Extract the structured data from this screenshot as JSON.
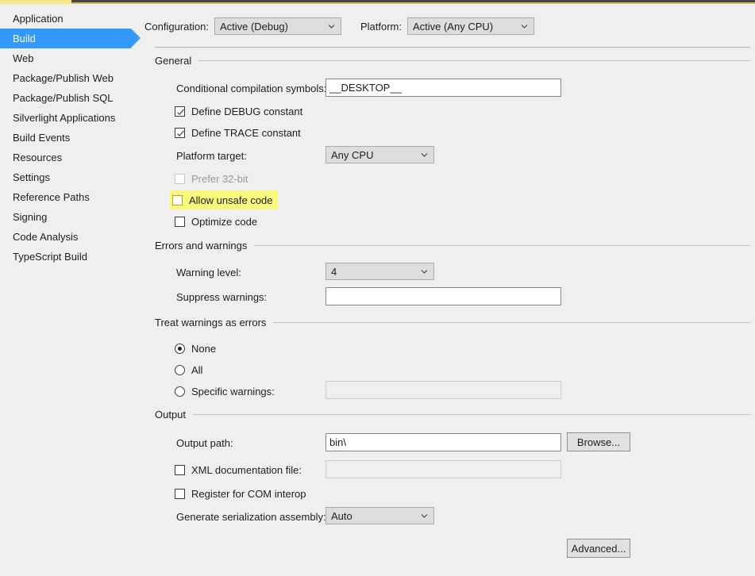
{
  "window": {
    "accent_yellow": "#f7e98a",
    "accent_dark": "#3f4551",
    "selection_blue": "#3399ff",
    "highlight_yellow": "#f8f87d",
    "background": "#efeff0"
  },
  "sidebar": {
    "items": [
      {
        "label": "Application",
        "selected": false
      },
      {
        "label": "Build",
        "selected": true
      },
      {
        "label": "Web",
        "selected": false
      },
      {
        "label": "Package/Publish Web",
        "selected": false
      },
      {
        "label": "Package/Publish SQL",
        "selected": false
      },
      {
        "label": "Silverlight Applications",
        "selected": false
      },
      {
        "label": "Build Events",
        "selected": false
      },
      {
        "label": "Resources",
        "selected": false
      },
      {
        "label": "Settings",
        "selected": false
      },
      {
        "label": "Reference Paths",
        "selected": false
      },
      {
        "label": "Signing",
        "selected": false
      },
      {
        "label": "Code Analysis",
        "selected": false
      },
      {
        "label": "TypeScript Build",
        "selected": false
      }
    ]
  },
  "toolbar": {
    "configuration_label": "Configuration:",
    "configuration_value": "Active (Debug)",
    "platform_label": "Platform:",
    "platform_value": "Active (Any CPU)"
  },
  "general": {
    "title": "General",
    "conditional_symbols_label": "Conditional compilation symbols:",
    "conditional_symbols_value": "__DESKTOP__",
    "define_debug_label": "Define DEBUG constant",
    "define_debug_checked": true,
    "define_trace_label": "Define TRACE constant",
    "define_trace_checked": true,
    "platform_target_label": "Platform target:",
    "platform_target_value": "Any CPU",
    "prefer_32bit_label": "Prefer 32-bit",
    "prefer_32bit_checked": false,
    "prefer_32bit_enabled": false,
    "allow_unsafe_label": "Allow unsafe code",
    "allow_unsafe_checked": false,
    "allow_unsafe_highlighted": true,
    "optimize_code_label": "Optimize code",
    "optimize_code_checked": false
  },
  "errors_and_warnings": {
    "title": "Errors and warnings",
    "warning_level_label": "Warning level:",
    "warning_level_value": "4",
    "suppress_warnings_label": "Suppress warnings:",
    "suppress_warnings_value": ""
  },
  "treat_warnings_as_errors": {
    "title": "Treat warnings as errors",
    "options": [
      {
        "label": "None",
        "selected": true
      },
      {
        "label": "All",
        "selected": false
      },
      {
        "label": "Specific warnings:",
        "selected": false
      }
    ],
    "specific_warnings_value": "",
    "specific_warnings_enabled": false
  },
  "output": {
    "title": "Output",
    "output_path_label": "Output path:",
    "output_path_value": "bin\\",
    "browse_label": "Browse...",
    "xml_doc_label": "XML documentation file:",
    "xml_doc_checked": false,
    "xml_doc_value": "",
    "xml_doc_enabled": false,
    "register_com_label": "Register for COM interop",
    "register_com_checked": false,
    "serialization_label": "Generate serialization assembly:",
    "serialization_value": "Auto"
  },
  "footer": {
    "advanced_label": "Advanced..."
  }
}
